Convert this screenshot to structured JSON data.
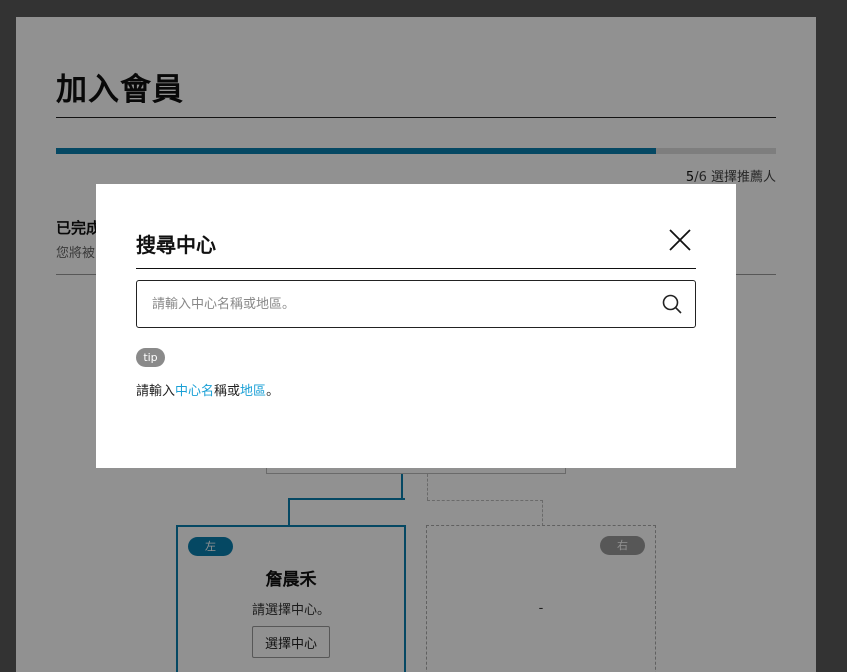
{
  "page": {
    "title": "加入會員",
    "progress": {
      "current": "5",
      "total": "/6",
      "step_name": " 選擇推薦人",
      "fraction": 0.833
    },
    "completed_title": "已完成",
    "completed_sub": "您將被",
    "tree": {
      "left_card": {
        "tag": "左",
        "name": "詹晨禾",
        "hint": "請選擇中心。",
        "button": "選擇中心"
      },
      "right_card": {
        "tag": "右",
        "placeholder": "-"
      }
    }
  },
  "modal": {
    "title": "搜尋中心",
    "search": {
      "placeholder": "請輸入中心名稱或地區。",
      "value": ""
    },
    "tip": {
      "badge": "tip",
      "parts": [
        "請輸入",
        "中心名",
        "稱或",
        "地區",
        "。"
      ]
    }
  },
  "colors": {
    "accent": "#0a7fae",
    "highlight": "#1aa0d6",
    "badge": "#8a8a8a"
  },
  "icons": {
    "close": "close-icon",
    "search": "search-icon"
  }
}
